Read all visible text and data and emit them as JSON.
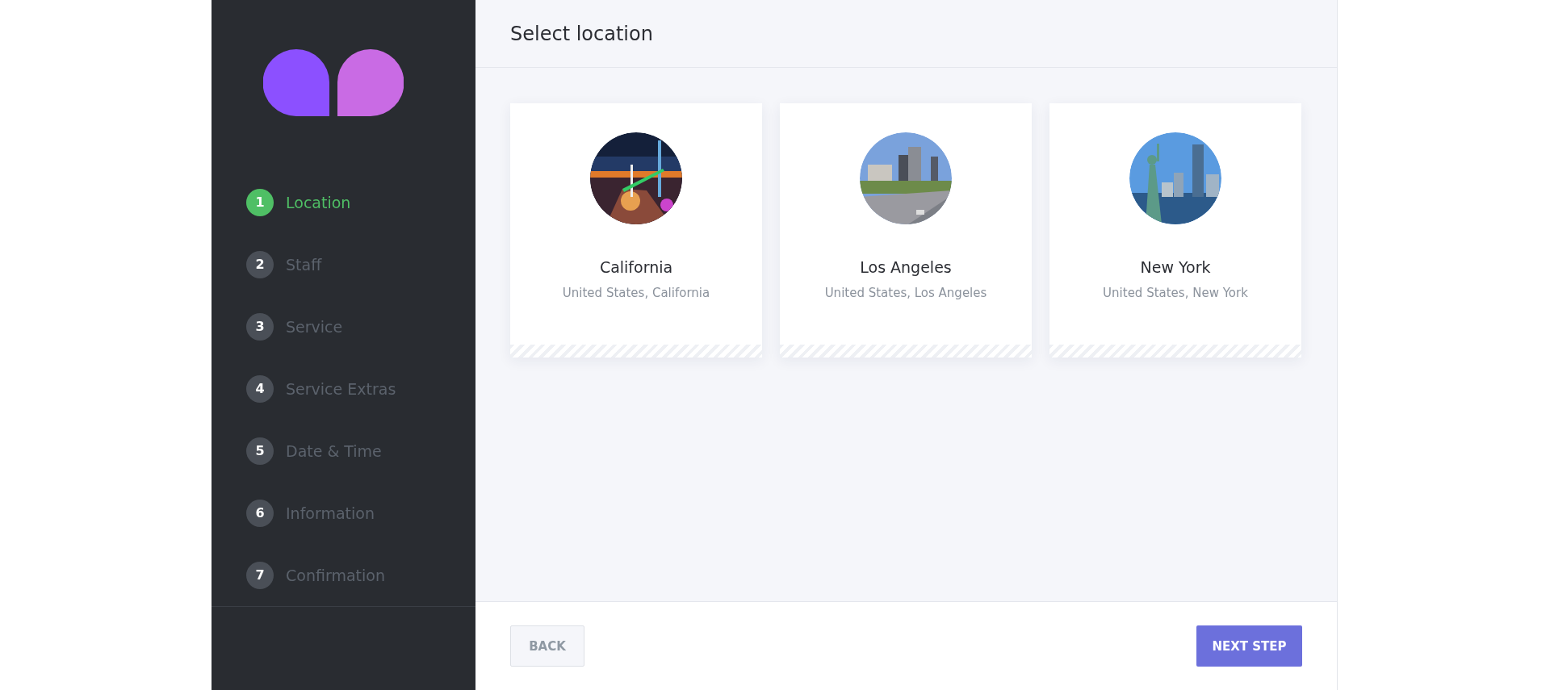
{
  "steps": [
    {
      "number": "1",
      "label": "Location",
      "selected": true
    },
    {
      "number": "2",
      "label": "Staff",
      "selected": false
    },
    {
      "number": "3",
      "label": "Service",
      "selected": false
    },
    {
      "number": "4",
      "label": "Service Extras",
      "selected": false
    },
    {
      "number": "5",
      "label": "Date & Time",
      "selected": false
    },
    {
      "number": "6",
      "label": "Information",
      "selected": false
    },
    {
      "number": "7",
      "label": "Confirmation",
      "selected": false
    }
  ],
  "header": {
    "title": "Select location"
  },
  "locations": [
    {
      "name": "California",
      "address": "United States, California",
      "kind": "night"
    },
    {
      "name": "Los Angeles",
      "address": "United States, Los Angeles",
      "kind": "city"
    },
    {
      "name": "New York",
      "address": "United States, New York",
      "kind": "skyline"
    }
  ],
  "footer": {
    "back": "BACK",
    "next": "NEXT STEP"
  }
}
